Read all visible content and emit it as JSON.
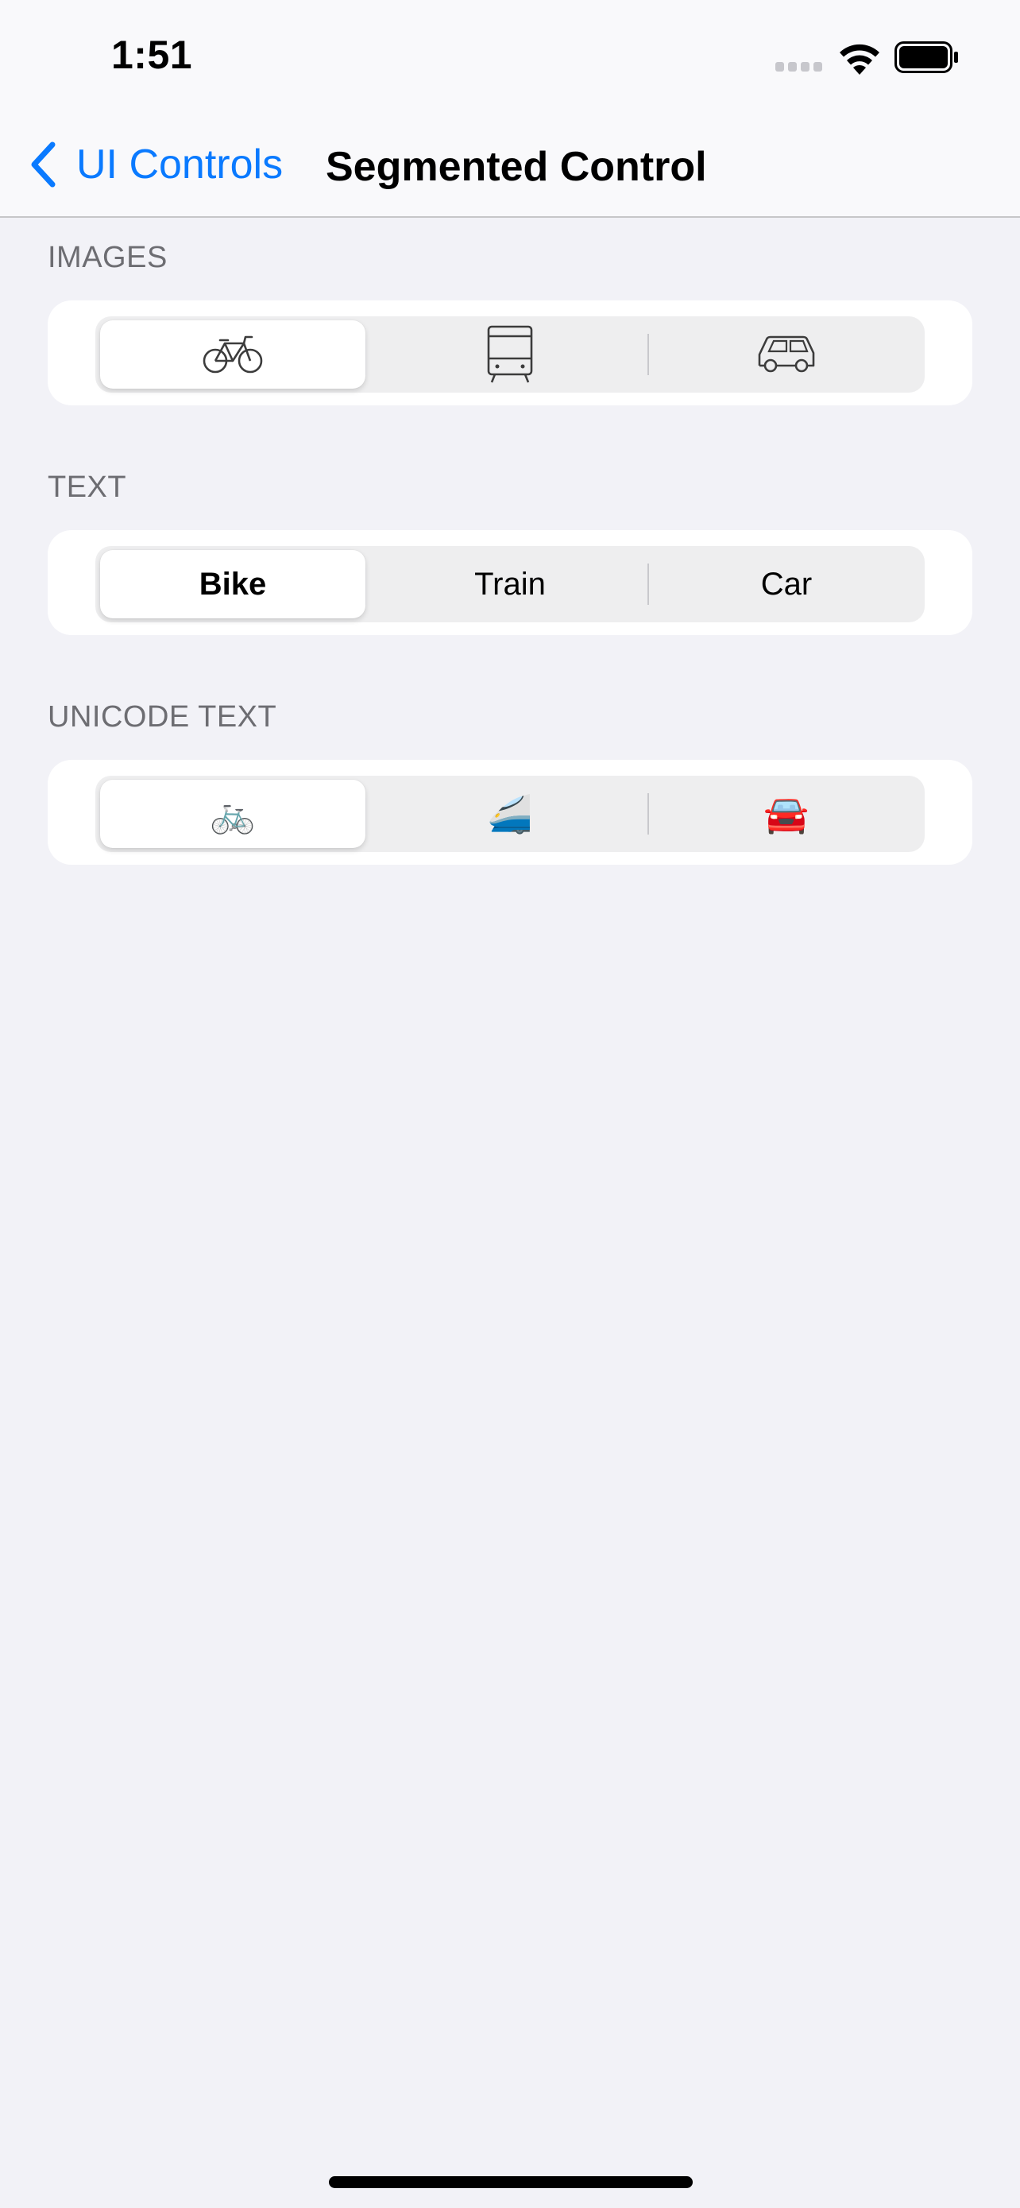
{
  "status_bar": {
    "time": "1:51"
  },
  "nav": {
    "back_label": "UI Controls",
    "title": "Segmented Control"
  },
  "sections": {
    "images": {
      "header": "IMAGES",
      "segments": [
        "bicycle-icon",
        "tram-icon",
        "car-icon"
      ],
      "selected_index": 0
    },
    "text": {
      "header": "TEXT",
      "segments": [
        "Bike",
        "Train",
        "Car"
      ],
      "selected_index": 0
    },
    "unicode": {
      "header": "UNICODE TEXT",
      "segments": [
        "🚲",
        "🚄",
        "🚘"
      ],
      "selected_index": 0
    }
  },
  "colors": {
    "accent": "#0a7aff",
    "background": "#f2f2f7",
    "card": "#ffffff",
    "segment_track": "#eeeeef",
    "header_text": "#6d6d72"
  }
}
